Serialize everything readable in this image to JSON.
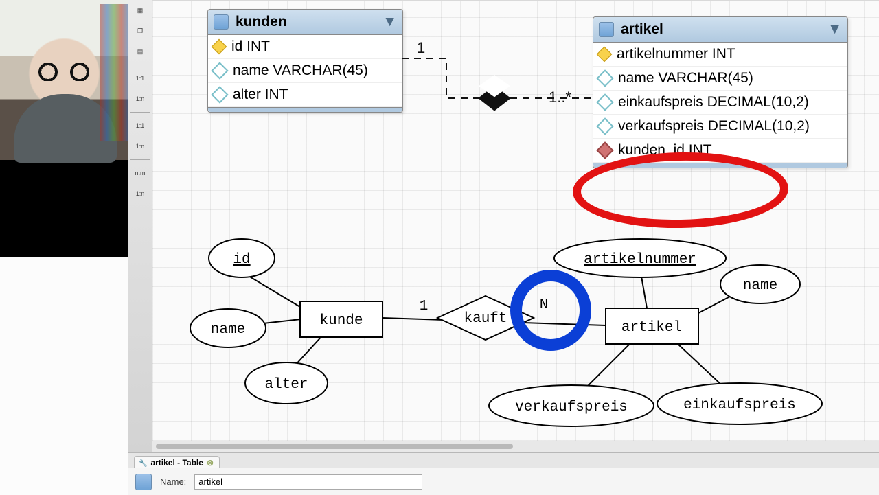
{
  "toolbar": {
    "items": [
      {
        "name": "grid-icon",
        "label": "▦"
      },
      {
        "name": "layers-icon",
        "label": "❐"
      },
      {
        "name": "notes-icon",
        "label": "▤"
      }
    ],
    "relations": [
      {
        "name": "rel-1-1-identifying",
        "label": "1:1"
      },
      {
        "name": "rel-1-n-identifying",
        "label": "1:n"
      },
      {
        "name": "rel-1-1-nonident",
        "label": "1:1"
      },
      {
        "name": "rel-1-n-nonident",
        "label": "1:n"
      },
      {
        "name": "rel-n-m",
        "label": "n:m"
      },
      {
        "name": "rel-1-n-self",
        "label": "1:n"
      }
    ]
  },
  "eer": {
    "cardinality_left": "1",
    "cardinality_right": "1..*",
    "tables": {
      "kunden": {
        "title": "kunden",
        "columns": [
          {
            "icon": "pk",
            "text": "id INT"
          },
          {
            "icon": "col",
            "text": "name VARCHAR(45)"
          },
          {
            "icon": "col",
            "text": "alter INT"
          }
        ]
      },
      "artikel": {
        "title": "artikel",
        "columns": [
          {
            "icon": "pk",
            "text": "artikelnummer INT"
          },
          {
            "icon": "col",
            "text": "name VARCHAR(45)"
          },
          {
            "icon": "col",
            "text": "einkaufspreis DECIMAL(10,2)"
          },
          {
            "icon": "col",
            "text": "verkaufspreis DECIMAL(10,2)"
          },
          {
            "icon": "fk",
            "text": "kunden_id INT"
          }
        ]
      }
    }
  },
  "chen": {
    "entities": {
      "kunde": "kunde",
      "artikel": "artikel",
      "relationship": "kauft",
      "card_left": "1",
      "card_right": "N"
    },
    "kunde_attrs": [
      "id",
      "name",
      "alter"
    ],
    "artikel_attrs": [
      "artikelnummer",
      "name",
      "verkaufspreis",
      "einkaufspreis"
    ]
  },
  "bottom": {
    "tab_label": "artikel - Table",
    "name_label": "Name:",
    "name_value": "artikel"
  }
}
